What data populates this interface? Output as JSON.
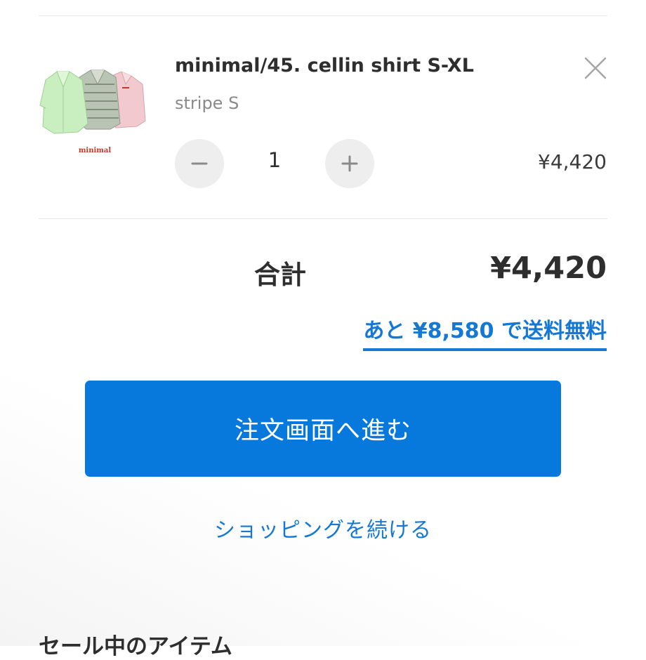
{
  "cart_item": {
    "title": "minimal/45. cellin shirt S-XL",
    "variant": "stripe S",
    "quantity": "1",
    "price": "¥4,420",
    "image_brand_text": "minimal",
    "remove_icon": "close-icon",
    "decrease_icon": "minus-icon",
    "increase_icon": "plus-icon"
  },
  "summary": {
    "total_label": "合計",
    "total_value": "¥4,420",
    "free_shipping_note": "あと ¥8,580 で送料無料"
  },
  "actions": {
    "checkout_label": "注文画面へ進む",
    "continue_shopping_label": "ショッピングを続ける"
  },
  "section": {
    "heading": "セール中のアイテム"
  },
  "colors": {
    "accent": "#0879dc",
    "link": "#1478d4",
    "text": "#2e2e2e",
    "muted": "#8a8a8a",
    "divider": "#e6e6e6",
    "button_bg": "#eeeeee"
  }
}
